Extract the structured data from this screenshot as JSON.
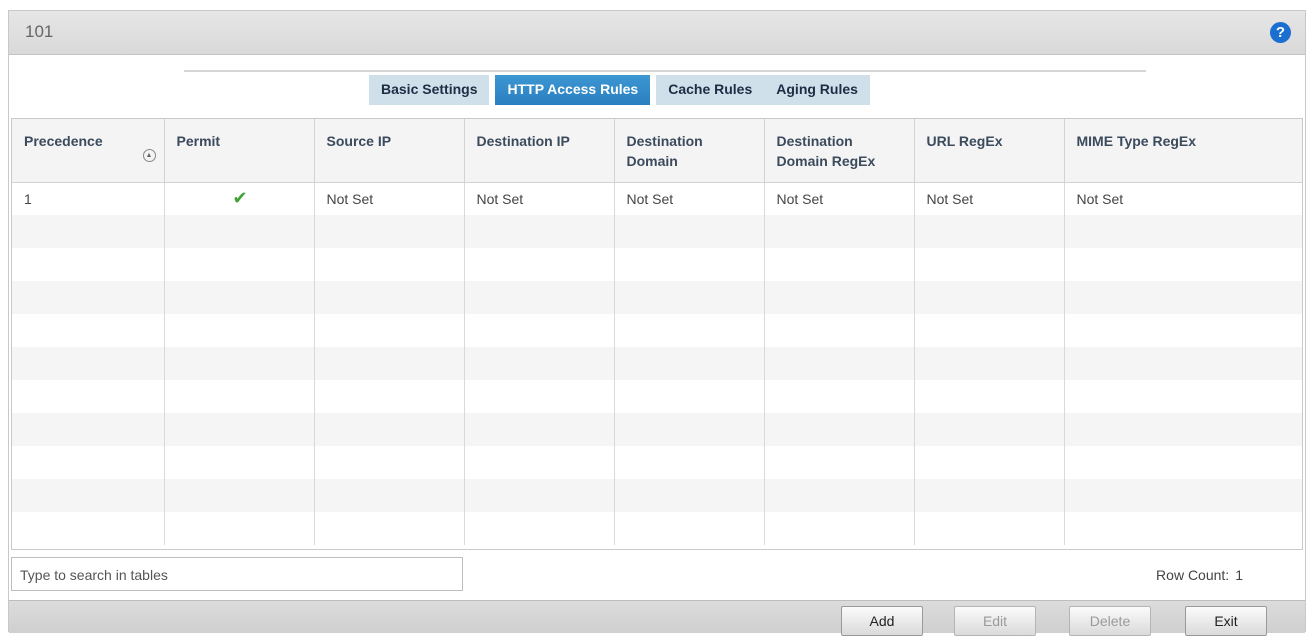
{
  "window": {
    "title": "101"
  },
  "tabs": [
    {
      "label": "Basic Settings"
    },
    {
      "label": "HTTP Access Rules"
    },
    {
      "label": "Cache Rules"
    },
    {
      "label": "Aging Rules"
    }
  ],
  "table": {
    "columns": [
      "Precedence",
      "Permit",
      "Source IP",
      "Destination IP",
      "Destination Domain",
      "Destination Domain RegEx",
      "URL RegEx",
      "MIME Type RegEx"
    ],
    "rows": [
      {
        "precedence": "1",
        "permit": "✔",
        "source_ip": "Not Set",
        "destination_ip": "Not Set",
        "destination_domain": "Not Set",
        "destination_domain_regex": "Not Set",
        "url_regex": "Not Set",
        "mime_type_regex": "Not Set"
      }
    ]
  },
  "search": {
    "placeholder": "Type to search in tables"
  },
  "row_count": {
    "label": "Row Count:",
    "value": "1"
  },
  "buttons": {
    "add": "Add",
    "edit": "Edit",
    "delete": "Delete",
    "exit": "Exit"
  },
  "icons": {
    "help": "help-icon",
    "sort": "sort-ascending-icon",
    "permit": "checkmark-icon"
  },
  "colors": {
    "active_tab": "#2b7fc0",
    "inactive_tab": "#cfe0ea",
    "check": "#3fa338",
    "help": "#1a6fd1"
  }
}
